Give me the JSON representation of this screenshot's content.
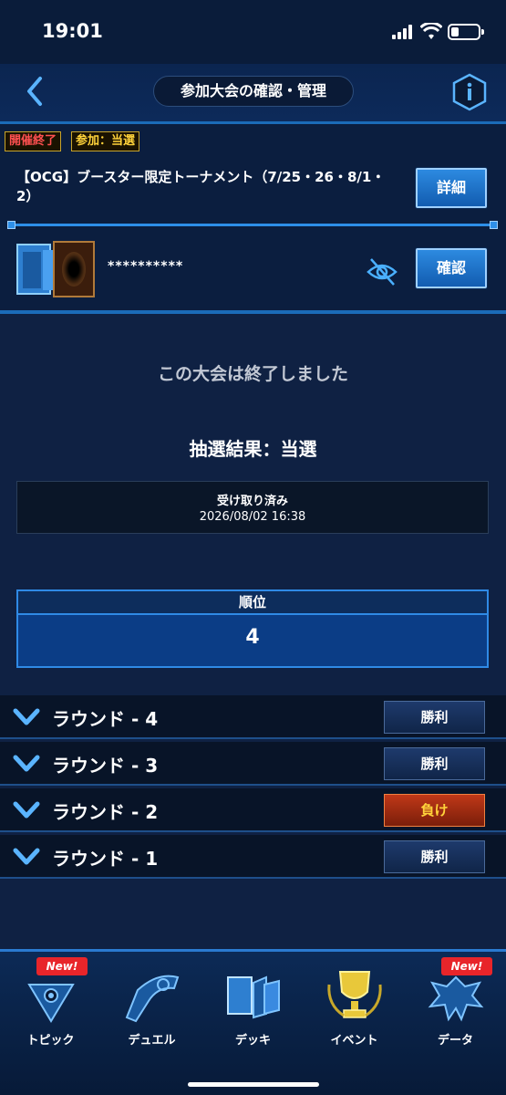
{
  "status_bar": {
    "time": "19:01"
  },
  "header": {
    "title": "参加大会の確認・管理"
  },
  "tournament": {
    "tags": [
      "開催終了",
      "参加：当選"
    ],
    "name": "【OCG】ブースター限定トーナメント（7/25・26・8/1・2）",
    "detail_label": "詳細",
    "deck_name": "**********",
    "confirm_label": "確認"
  },
  "status": {
    "ended_message": "この大会は終了しました",
    "lottery_result": "抽選結果：当選"
  },
  "receipt": {
    "label": "受け取り済み",
    "date": "2026/08/02 16:38"
  },
  "rank": {
    "label": "順位",
    "value": "4"
  },
  "rounds": [
    {
      "label": "ラウンド - 4",
      "result": "勝利"
    },
    {
      "label": "ラウンド - 3",
      "result": "勝利"
    },
    {
      "label": "ラウンド - 2",
      "result": "負け"
    },
    {
      "label": "ラウンド - 1",
      "result": "勝利"
    }
  ],
  "nav": {
    "items": [
      {
        "label": "トピック",
        "badge": "New!",
        "icon": "topic-icon"
      },
      {
        "label": "デュエル",
        "badge": "",
        "icon": "duel-icon"
      },
      {
        "label": "デッキ",
        "badge": "",
        "icon": "deck-icon"
      },
      {
        "label": "イベント",
        "badge": "",
        "icon": "event-icon"
      },
      {
        "label": "データ",
        "badge": "New!",
        "icon": "data-icon"
      }
    ]
  },
  "colors": {
    "accent": "#2e8fe8",
    "win": "#1e3a6c",
    "lose": "#c03818",
    "tag_ended": "#ff5050",
    "tag_entry": "#ffd23a"
  }
}
